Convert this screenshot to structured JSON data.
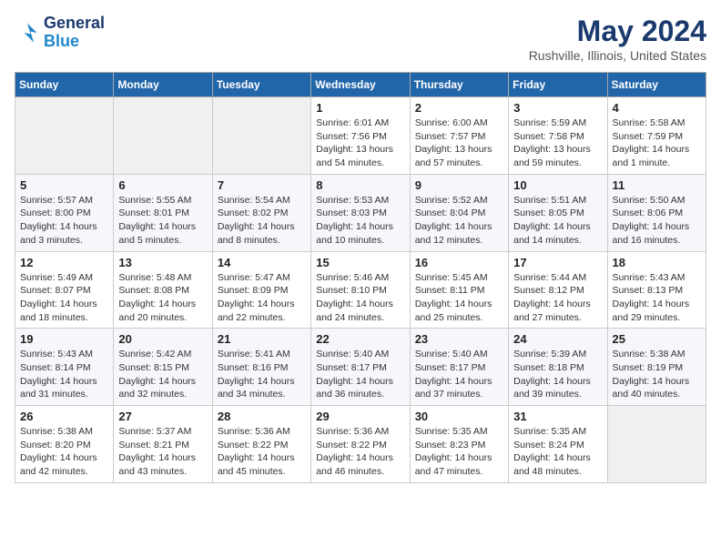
{
  "header": {
    "logo_general": "General",
    "logo_blue": "Blue",
    "month": "May 2024",
    "location": "Rushville, Illinois, United States"
  },
  "days_of_week": [
    "Sunday",
    "Monday",
    "Tuesday",
    "Wednesday",
    "Thursday",
    "Friday",
    "Saturday"
  ],
  "weeks": [
    [
      {
        "day": "",
        "empty": true
      },
      {
        "day": "",
        "empty": true
      },
      {
        "day": "",
        "empty": true
      },
      {
        "day": "1",
        "sunrise": "6:01 AM",
        "sunset": "7:56 PM",
        "daylight": "13 hours and 54 minutes."
      },
      {
        "day": "2",
        "sunrise": "6:00 AM",
        "sunset": "7:57 PM",
        "daylight": "13 hours and 57 minutes."
      },
      {
        "day": "3",
        "sunrise": "5:59 AM",
        "sunset": "7:58 PM",
        "daylight": "13 hours and 59 minutes."
      },
      {
        "day": "4",
        "sunrise": "5:58 AM",
        "sunset": "7:59 PM",
        "daylight": "14 hours and 1 minute."
      }
    ],
    [
      {
        "day": "5",
        "sunrise": "5:57 AM",
        "sunset": "8:00 PM",
        "daylight": "14 hours and 3 minutes."
      },
      {
        "day": "6",
        "sunrise": "5:55 AM",
        "sunset": "8:01 PM",
        "daylight": "14 hours and 5 minutes."
      },
      {
        "day": "7",
        "sunrise": "5:54 AM",
        "sunset": "8:02 PM",
        "daylight": "14 hours and 8 minutes."
      },
      {
        "day": "8",
        "sunrise": "5:53 AM",
        "sunset": "8:03 PM",
        "daylight": "14 hours and 10 minutes."
      },
      {
        "day": "9",
        "sunrise": "5:52 AM",
        "sunset": "8:04 PM",
        "daylight": "14 hours and 12 minutes."
      },
      {
        "day": "10",
        "sunrise": "5:51 AM",
        "sunset": "8:05 PM",
        "daylight": "14 hours and 14 minutes."
      },
      {
        "day": "11",
        "sunrise": "5:50 AM",
        "sunset": "8:06 PM",
        "daylight": "14 hours and 16 minutes."
      }
    ],
    [
      {
        "day": "12",
        "sunrise": "5:49 AM",
        "sunset": "8:07 PM",
        "daylight": "14 hours and 18 minutes."
      },
      {
        "day": "13",
        "sunrise": "5:48 AM",
        "sunset": "8:08 PM",
        "daylight": "14 hours and 20 minutes."
      },
      {
        "day": "14",
        "sunrise": "5:47 AM",
        "sunset": "8:09 PM",
        "daylight": "14 hours and 22 minutes."
      },
      {
        "day": "15",
        "sunrise": "5:46 AM",
        "sunset": "8:10 PM",
        "daylight": "14 hours and 24 minutes."
      },
      {
        "day": "16",
        "sunrise": "5:45 AM",
        "sunset": "8:11 PM",
        "daylight": "14 hours and 25 minutes."
      },
      {
        "day": "17",
        "sunrise": "5:44 AM",
        "sunset": "8:12 PM",
        "daylight": "14 hours and 27 minutes."
      },
      {
        "day": "18",
        "sunrise": "5:43 AM",
        "sunset": "8:13 PM",
        "daylight": "14 hours and 29 minutes."
      }
    ],
    [
      {
        "day": "19",
        "sunrise": "5:43 AM",
        "sunset": "8:14 PM",
        "daylight": "14 hours and 31 minutes."
      },
      {
        "day": "20",
        "sunrise": "5:42 AM",
        "sunset": "8:15 PM",
        "daylight": "14 hours and 32 minutes."
      },
      {
        "day": "21",
        "sunrise": "5:41 AM",
        "sunset": "8:16 PM",
        "daylight": "14 hours and 34 minutes."
      },
      {
        "day": "22",
        "sunrise": "5:40 AM",
        "sunset": "8:17 PM",
        "daylight": "14 hours and 36 minutes."
      },
      {
        "day": "23",
        "sunrise": "5:40 AM",
        "sunset": "8:17 PM",
        "daylight": "14 hours and 37 minutes."
      },
      {
        "day": "24",
        "sunrise": "5:39 AM",
        "sunset": "8:18 PM",
        "daylight": "14 hours and 39 minutes."
      },
      {
        "day": "25",
        "sunrise": "5:38 AM",
        "sunset": "8:19 PM",
        "daylight": "14 hours and 40 minutes."
      }
    ],
    [
      {
        "day": "26",
        "sunrise": "5:38 AM",
        "sunset": "8:20 PM",
        "daylight": "14 hours and 42 minutes."
      },
      {
        "day": "27",
        "sunrise": "5:37 AM",
        "sunset": "8:21 PM",
        "daylight": "14 hours and 43 minutes."
      },
      {
        "day": "28",
        "sunrise": "5:36 AM",
        "sunset": "8:22 PM",
        "daylight": "14 hours and 45 minutes."
      },
      {
        "day": "29",
        "sunrise": "5:36 AM",
        "sunset": "8:22 PM",
        "daylight": "14 hours and 46 minutes."
      },
      {
        "day": "30",
        "sunrise": "5:35 AM",
        "sunset": "8:23 PM",
        "daylight": "14 hours and 47 minutes."
      },
      {
        "day": "31",
        "sunrise": "5:35 AM",
        "sunset": "8:24 PM",
        "daylight": "14 hours and 48 minutes."
      },
      {
        "day": "",
        "empty": true
      }
    ]
  ]
}
